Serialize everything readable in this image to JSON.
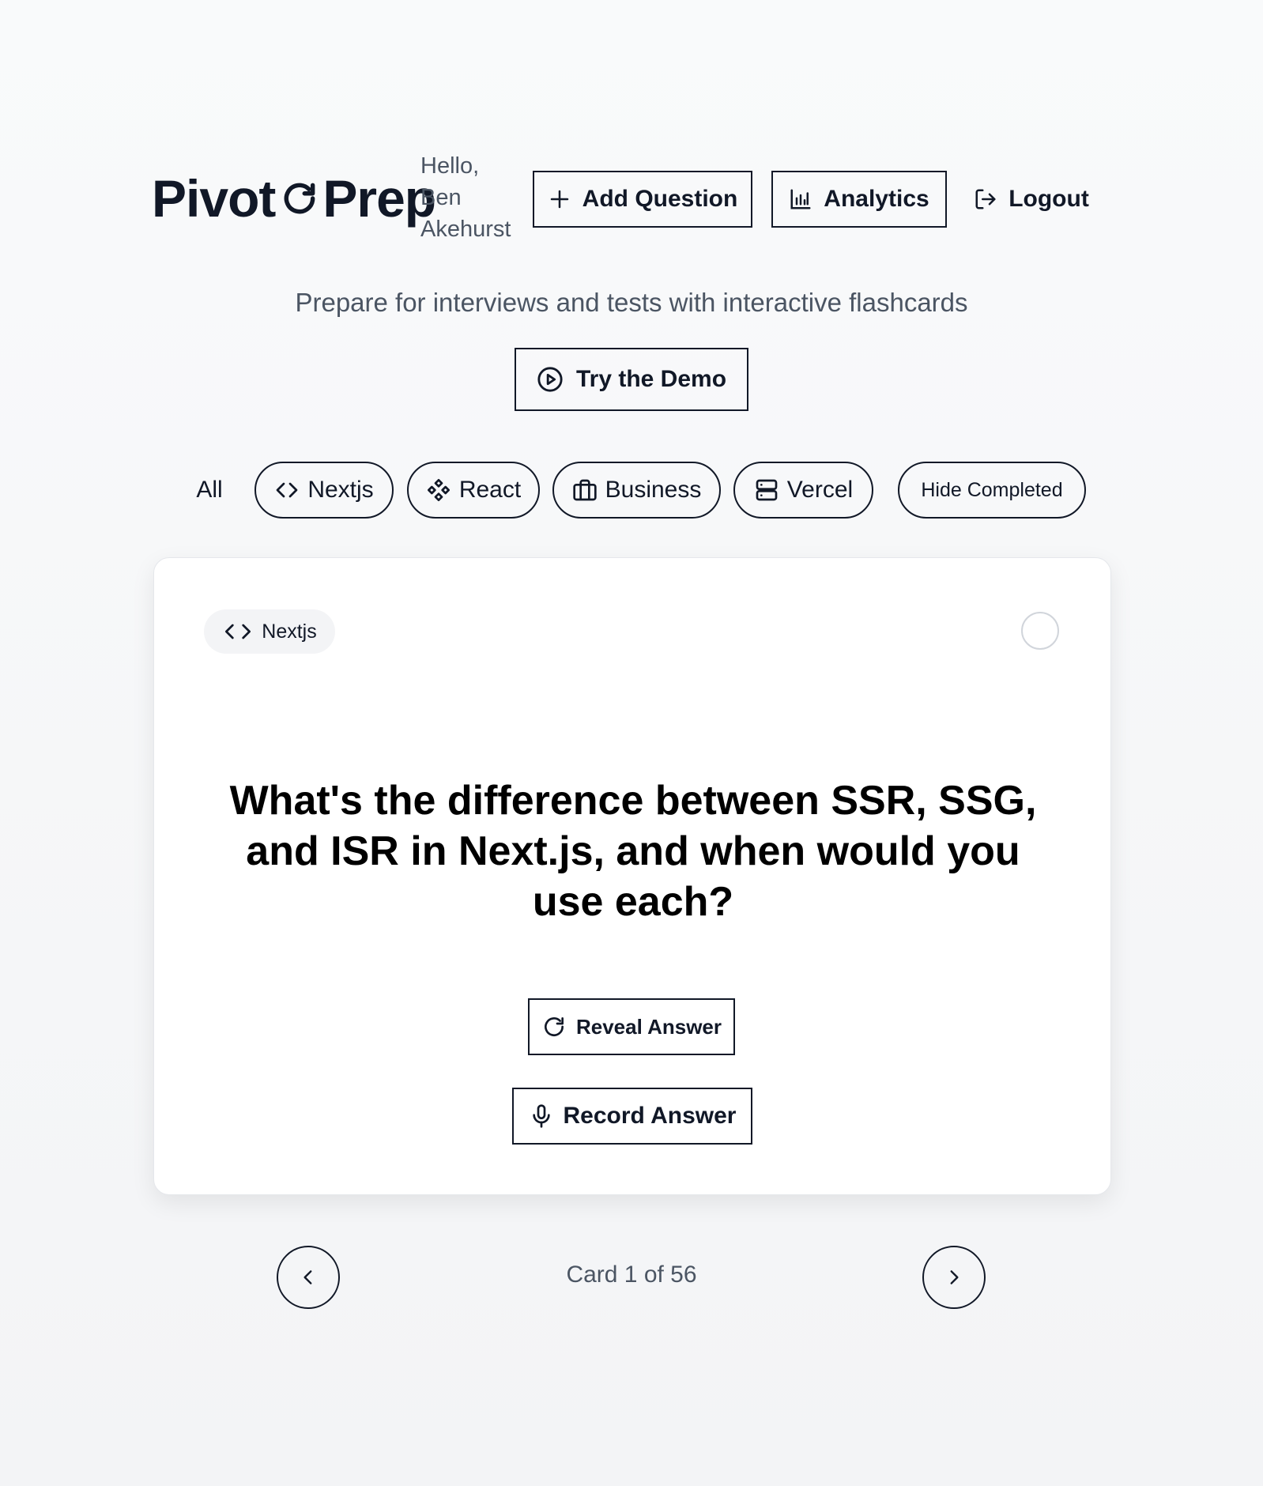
{
  "header": {
    "logo_left": "Pivot",
    "logo_right": "Prep",
    "greeting": "Hello, Ben Akehurst",
    "add_question_label": "Add Question",
    "analytics_label": "Analytics",
    "logout_label": "Logout"
  },
  "tagline": "Prepare for interviews and tests with interactive flashcards",
  "demo": {
    "label": "Try the Demo"
  },
  "filters": {
    "all": "All",
    "nextjs": "Nextjs",
    "react": "React",
    "business": "Business",
    "vercel": "Vercel",
    "hide_completed": "Hide Completed"
  },
  "card": {
    "tag": "Nextjs",
    "question": "What's the difference between SSR, SSG, and ISR in Next.js, and when would you use each?",
    "reveal_label": "Reveal Answer",
    "record_label": "Record Answer"
  },
  "navigation": {
    "counter": "Card 1 of 56"
  },
  "colors": {
    "text_primary": "#111827",
    "text_secondary": "#4b5563",
    "card_bg": "#ffffff",
    "page_bg": "#f3f4f6"
  }
}
